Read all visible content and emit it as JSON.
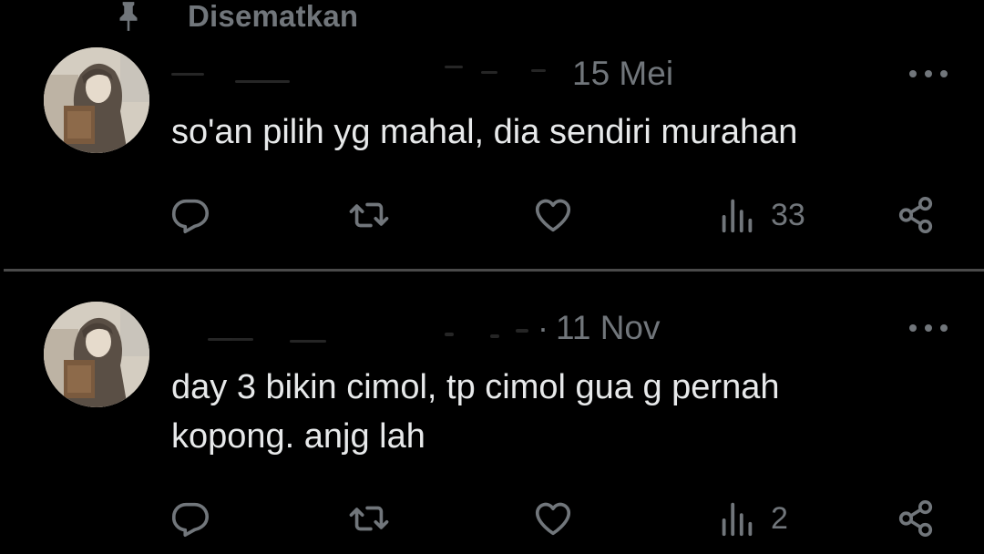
{
  "pinned": {
    "label": "Disematkan",
    "icon": "pin-icon"
  },
  "colors": {
    "background": "#000000",
    "text_primary": "#e7e9ea",
    "text_secondary": "#71767b",
    "divider": "#4a4a4a"
  },
  "tweets": [
    {
      "date": "15 Mei",
      "text": "so'an pilih yg mahal, dia sendiri murahan",
      "actions": {
        "reply_icon": "reply-icon",
        "retweet_icon": "retweet-icon",
        "like_icon": "heart-icon",
        "views_icon": "views-icon",
        "views_count": "33",
        "share_icon": "share-icon"
      },
      "more_icon": "more-icon"
    },
    {
      "date": "11 Nov",
      "separator": "·",
      "text": "day 3 bikin cimol, tp cimol gua g pernah\nkopong. anjg lah",
      "actions": {
        "reply_icon": "reply-icon",
        "retweet_icon": "retweet-icon",
        "like_icon": "heart-icon",
        "views_icon": "views-icon",
        "views_count": "2",
        "share_icon": "share-icon"
      },
      "more_icon": "more-icon"
    }
  ]
}
